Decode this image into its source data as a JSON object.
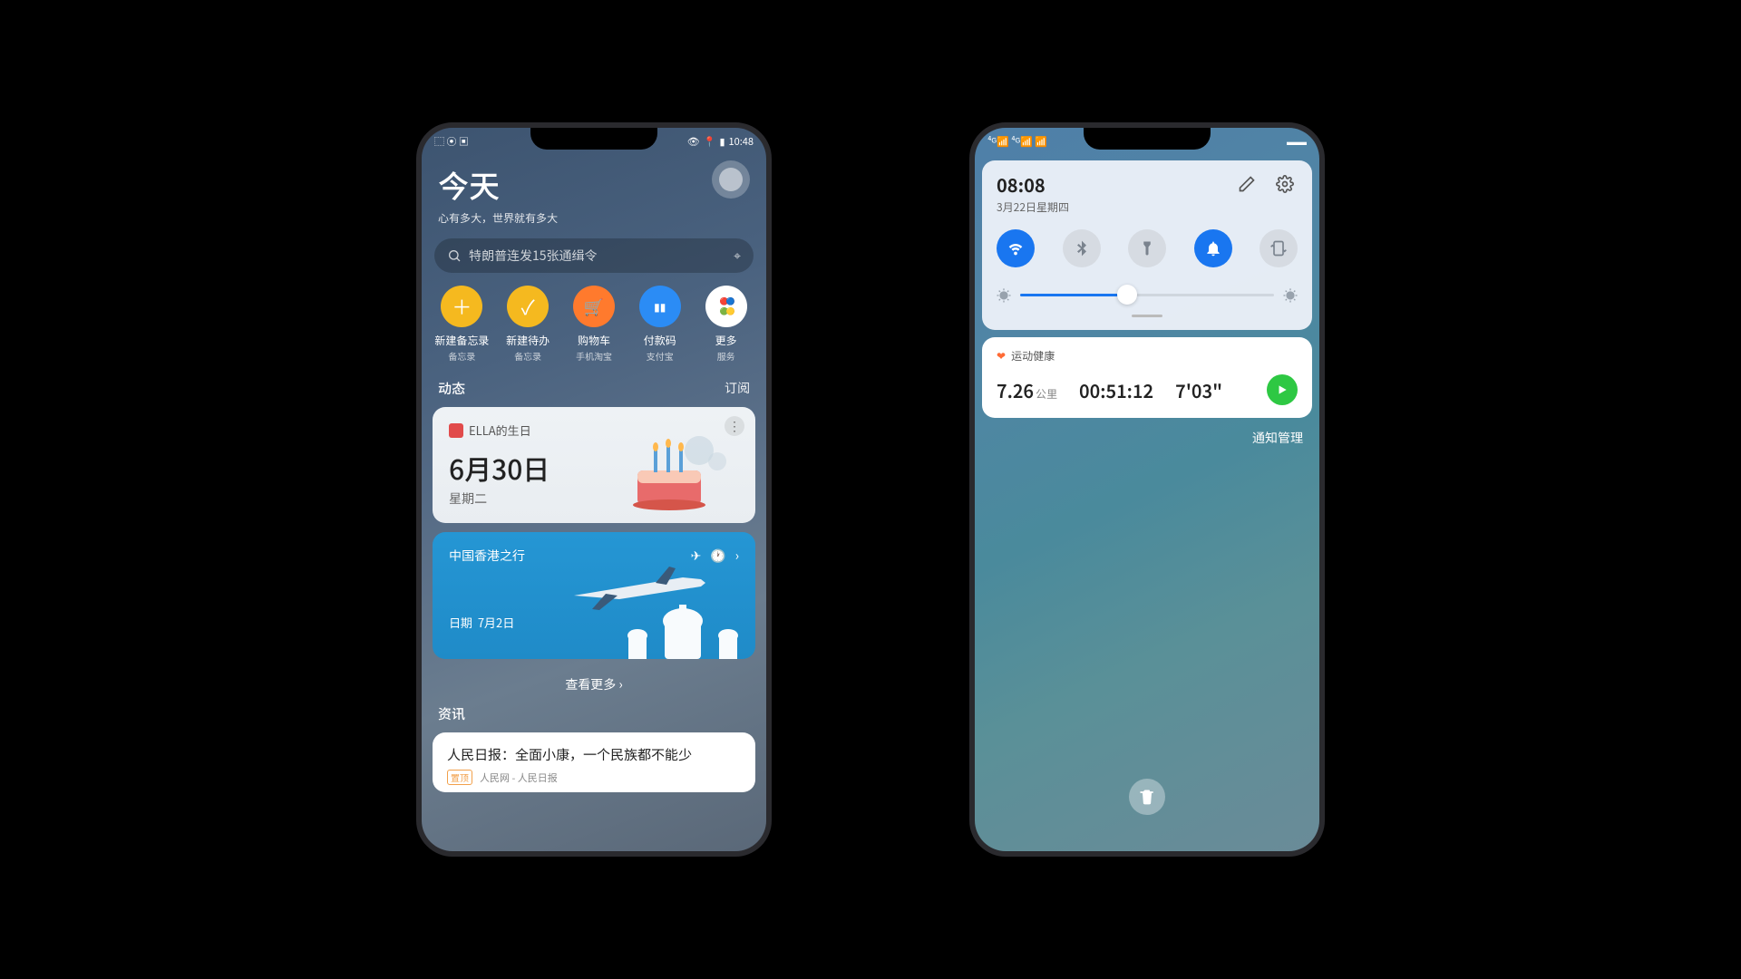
{
  "left": {
    "status_time": "10:48",
    "header": {
      "title": "今天",
      "subtitle": "心有多大，世界就有多大"
    },
    "search_placeholder": "特朗普连发15张通缉令",
    "quick": [
      {
        "label": "新建备忘录",
        "sub": "备忘录",
        "color": "#f5b91f",
        "gly": "＋"
      },
      {
        "label": "新建待办",
        "sub": "备忘录",
        "color": "#f5b91f",
        "gly": "✓"
      },
      {
        "label": "购物车",
        "sub": "手机淘宝",
        "color": "#ff7a2d",
        "gly": "🛒"
      },
      {
        "label": "付款码",
        "sub": "支付宝",
        "color": "#2b8cf5",
        "gly": "▮▮"
      },
      {
        "label": "更多",
        "sub": "服务",
        "color": "#ffffff",
        "gly": "⠿"
      }
    ],
    "section": {
      "left": "动态",
      "right": "订阅"
    },
    "bday": {
      "label": "ELLA的生日",
      "date": "6月30日",
      "day": "星期二"
    },
    "trip": {
      "title": "中国香港之行",
      "date_label": "日期",
      "date": "7月2日"
    },
    "view_more": "查看更多",
    "news_section": "资讯",
    "news": {
      "headline": "人民日报：全面小康，一个民族都不能少",
      "pin": "置顶",
      "source": "人民网 - 人民日报"
    }
  },
  "right": {
    "panel": {
      "time": "08:08",
      "date": "3月22日星期四"
    },
    "health": {
      "title": "运动健康",
      "distance": "7.26",
      "dist_unit": "公里",
      "duration": "00:51:12",
      "pace": "7'03\""
    },
    "notify": "通知管理"
  }
}
